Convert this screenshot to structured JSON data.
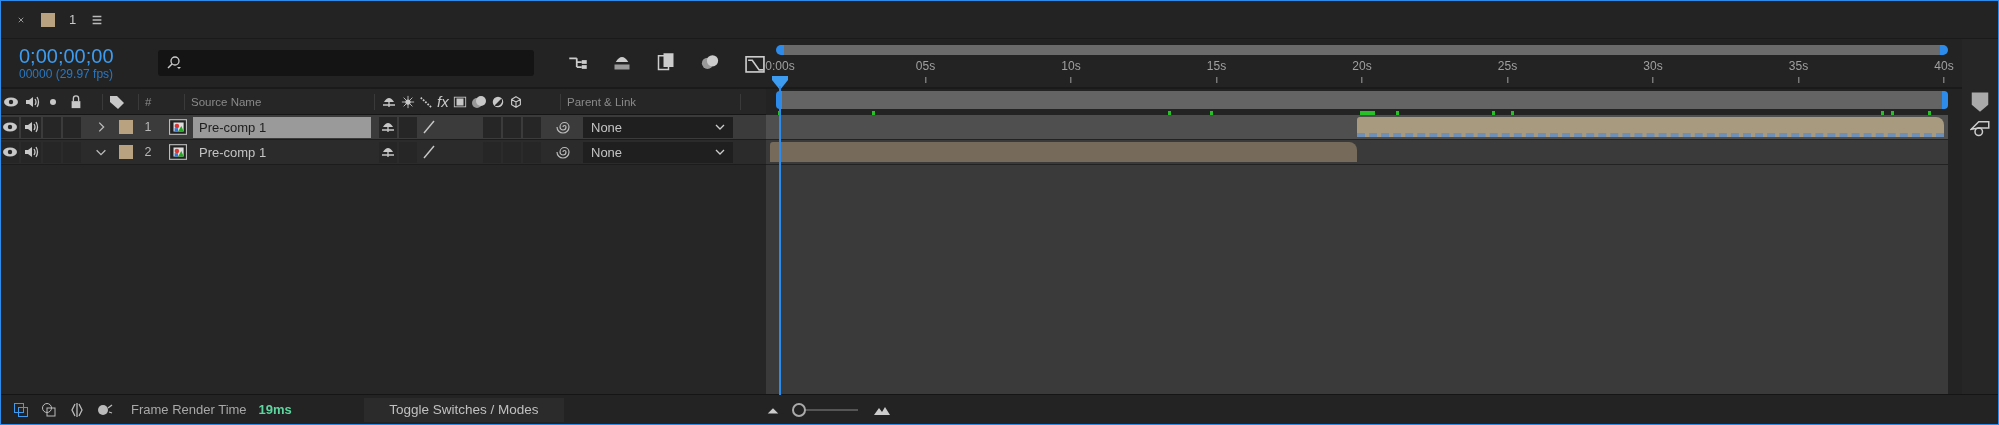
{
  "tab": {
    "title": "1",
    "color": "#b8a27f"
  },
  "time": {
    "timecode": "0;00;00;00",
    "frame": "00000 (29.97 fps)"
  },
  "columns": {
    "number": "#",
    "source_name": "Source Name",
    "effects": "fx",
    "parent": "Parent & Link"
  },
  "ruler": [
    "0:00s",
    "05s",
    "10s",
    "15s",
    "20s",
    "25s",
    "30s",
    "35s",
    "40s"
  ],
  "layers": [
    {
      "number": "1",
      "name": "Pre-comp 1",
      "color": "#b8a27f",
      "expanded": false,
      "selected": true,
      "parent": "None"
    },
    {
      "number": "2",
      "name": "Pre-comp 1",
      "color": "#b8a27f",
      "expanded": true,
      "selected": false,
      "parent": "None"
    }
  ],
  "status": {
    "label": "Frame Render Time",
    "value": "19ms",
    "toggle": "Toggle Switches / Modes",
    "zoom": {
      "level": 0.08
    }
  }
}
